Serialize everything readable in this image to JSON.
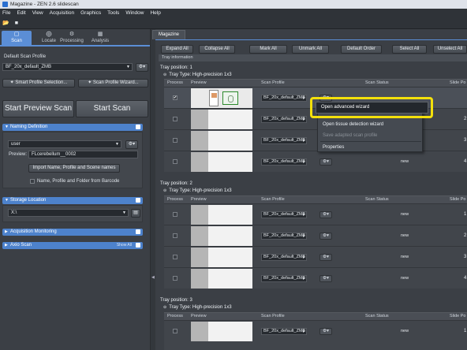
{
  "titlebar": {
    "title": "Magazine - ZEN 2.6 slidescan"
  },
  "menubar": [
    "File",
    "Edit",
    "View",
    "Acquisition",
    "Graphics",
    "Tools",
    "Window",
    "Help"
  ],
  "left": {
    "tabs": [
      {
        "label": "Scan",
        "icon": "scan-icon"
      },
      {
        "label": "Locate",
        "icon": "locate-icon"
      },
      {
        "label": "Processing",
        "icon": "processing-icon"
      },
      {
        "label": "Analysis",
        "icon": "analysis-icon"
      }
    ],
    "default_profile_label": "Default Scan Profile",
    "default_profile_value": "BF_20x_default_ZMB",
    "smart_profile_btn": "Smart Profile Selection...",
    "scan_wizard_btn": "Scan Profile Wizard...",
    "start_preview_btn": "Start Preview Scan",
    "start_scan_btn": "Start Scan",
    "naming": {
      "title": "Naming Definition",
      "user_value": "user",
      "preview_label": "Preview:",
      "preview_value": "FLcerebellum__0002",
      "import_btn": "Import Name, Profile and Scene names",
      "barcode_label": "Name, Profile and Folder from Barcode"
    },
    "storage": {
      "title": "Storage Location",
      "path_value": "X:\\"
    },
    "acq_title": "Acquisition Monitoring",
    "axio": {
      "title": "Axio Scan",
      "show_all": "Show All"
    }
  },
  "right": {
    "tab_label": "Magazine",
    "buttons": [
      "Expand All",
      "Collapse All",
      "Mark All",
      "Unmark All",
      "Default Order",
      "Select All",
      "Unselect All"
    ],
    "tray_info": "Tray information",
    "columns": {
      "process": "Process",
      "preview": "Preview",
      "scan_profile": "Scan Profile",
      "scan_status": "Scan Status",
      "slide_pos": "Slide Po"
    },
    "trays": [
      {
        "pos_label": "Tray position:  1",
        "type_label": "Tray Type:  High-precision 1x3",
        "rows": [
          {
            "checked": "✔",
            "profile": "BF_20x_default_ZMB",
            "status": "",
            "slide": ""
          },
          {
            "checked": "",
            "profile": "BF_20x_default_ZMB",
            "status": "",
            "slide": "2"
          },
          {
            "checked": "",
            "profile": "BF_20x_default_ZMB",
            "status": "",
            "slide": "3"
          },
          {
            "checked": "",
            "profile": "BF_20x_default_ZMB",
            "status": "new",
            "slide": "4"
          }
        ]
      },
      {
        "pos_label": "Tray position:  2",
        "type_label": "Tray Type:  High-precision 1x3",
        "rows": [
          {
            "checked": "",
            "profile": "BF_20x_default_ZMB",
            "status": "new",
            "slide": "1"
          },
          {
            "checked": "",
            "profile": "BF_20x_default_ZMB",
            "status": "new",
            "slide": "2"
          },
          {
            "checked": "",
            "profile": "BF_20x_default_ZMB",
            "status": "new",
            "slide": "3"
          },
          {
            "checked": "",
            "profile": "BF_20x_default_ZMB",
            "status": "new",
            "slide": "4"
          }
        ]
      },
      {
        "pos_label": "Tray position:  3",
        "type_label": "Tray Type:  High-precision 1x3",
        "rows": [
          {
            "checked": "",
            "profile": "BF_20x_default_ZMB",
            "status": "new",
            "slide": "1"
          }
        ]
      }
    ],
    "context_menu": {
      "items": [
        "Open advanced wizard",
        "Open tissue detection wizard",
        "Save adapted scan profile",
        "Properties"
      ]
    }
  },
  "colors": {
    "accent": "#5b8ed6",
    "highlight": "#f4e00b",
    "background": "#3b3f45"
  }
}
